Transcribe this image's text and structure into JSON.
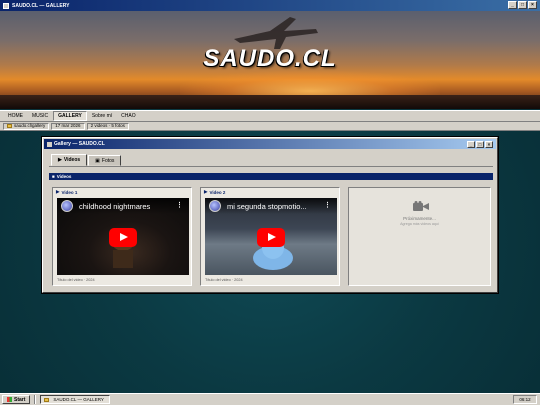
{
  "window": {
    "title": "SAUDO.CL — GALLERY",
    "buttons": {
      "minimize": "_",
      "maximize": "□",
      "close": "×"
    }
  },
  "banner": {
    "logo": "SAUDO.CL"
  },
  "menu": {
    "items": [
      {
        "label": "HOME"
      },
      {
        "label": "MUSIC"
      },
      {
        "label": "GALLERY",
        "active": true
      },
      {
        "label": "Sobre mí"
      },
      {
        "label": "CHAO"
      }
    ]
  },
  "status": {
    "path": "saudo.cl\\gallery",
    "date": "17 mar 2026",
    "counts": "2 videos · 5 fotos"
  },
  "gallery": {
    "title": "Gallery — SAUDO.CL",
    "tabs": [
      {
        "label": "Videos",
        "active": true
      },
      {
        "label": "Fotos"
      }
    ],
    "section": "Videos",
    "videos": [
      {
        "header": "Video 1",
        "title": "childhood nightmares",
        "caption": "Título del video · 2024"
      },
      {
        "header": "Video 2",
        "title": "mi segunda stopmotio...",
        "caption": "Título del video · 2024"
      }
    ],
    "placeholder": {
      "label": "Próximamente...",
      "hint": "Agrega más videos aquí"
    }
  },
  "taskbar": {
    "start": "Start",
    "task": "SAUDO.CL — GALLERY",
    "clock": "06:12"
  },
  "colors": {
    "titlebar": "#0a246a",
    "chrome": "#d4d0c8",
    "play": "#ff0000",
    "desktop": "#0b3942"
  }
}
